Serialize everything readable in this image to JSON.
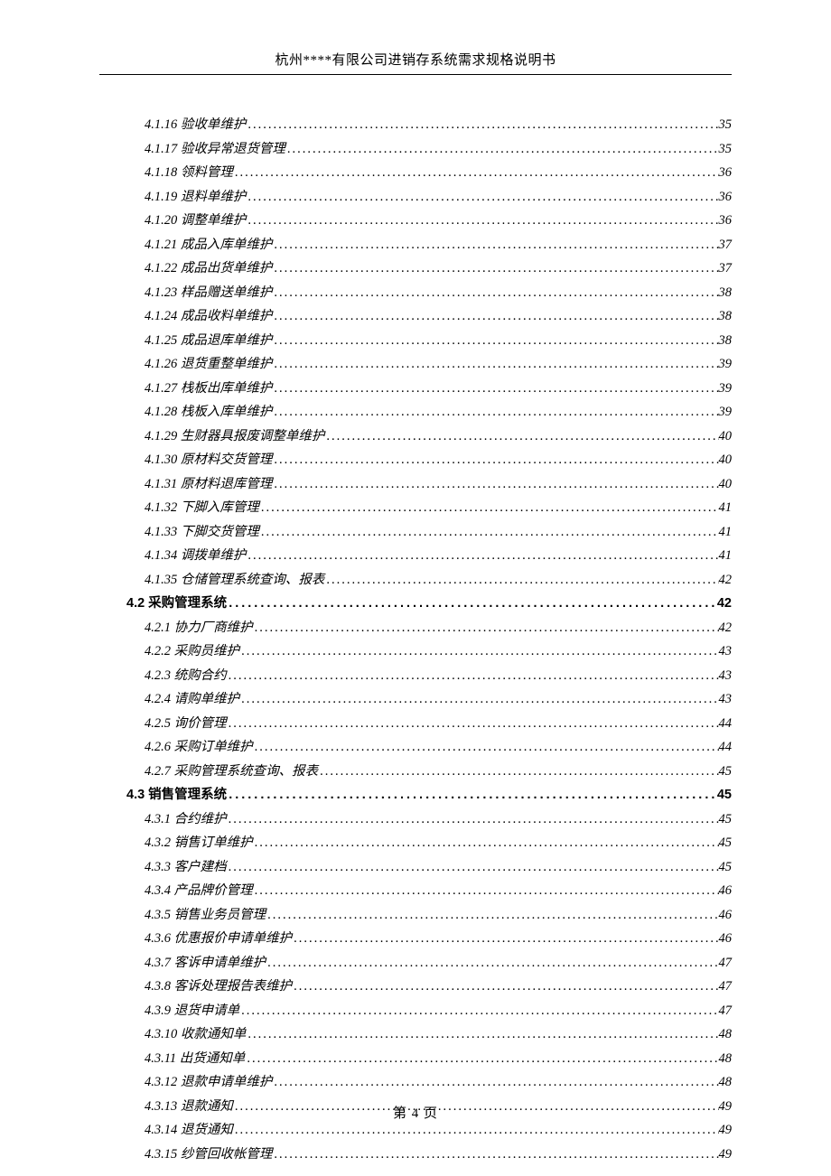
{
  "header_title": "杭州****有限公司进销存系统需求规格说明书",
  "footer_prefix": "第 ",
  "footer_page": "4",
  "footer_suffix": " 页",
  "toc": [
    {
      "level": 1,
      "num": "4.1.16",
      "title": "验收单维护",
      "page": "35"
    },
    {
      "level": 1,
      "num": "4.1.17",
      "title": "验收异常退货管理",
      "page": "35"
    },
    {
      "level": 1,
      "num": "4.1.18",
      "title": "领料管理",
      "page": "36"
    },
    {
      "level": 1,
      "num": "4.1.19",
      "title": "退料单维护",
      "page": "36"
    },
    {
      "level": 1,
      "num": "4.1.20",
      "title": "调整单维护",
      "page": "36"
    },
    {
      "level": 1,
      "num": "4.1.21",
      "title": "成品入库单维护",
      "page": "37"
    },
    {
      "level": 1,
      "num": "4.1.22",
      "title": "成品出货单维护",
      "page": "37"
    },
    {
      "level": 1,
      "num": "4.1.23",
      "title": "样品赠送单维护",
      "page": "38"
    },
    {
      "level": 1,
      "num": "4.1.24",
      "title": "成品收料单维护",
      "page": "38"
    },
    {
      "level": 1,
      "num": "4.1.25",
      "title": "成品退库单维护",
      "page": "38"
    },
    {
      "level": 1,
      "num": "4.1.26",
      "title": "退货重整单维护",
      "page": "39"
    },
    {
      "level": 1,
      "num": "4.1.27",
      "title": "栈板出库单维护",
      "page": "39"
    },
    {
      "level": 1,
      "num": "4.1.28",
      "title": "栈板入库单维护",
      "page": "39"
    },
    {
      "level": 1,
      "num": "4.1.29",
      "title": "生财器具报废调整单维护",
      "page": "40"
    },
    {
      "level": 1,
      "num": "4.1.30",
      "title": "原材料交货管理",
      "page": "40"
    },
    {
      "level": 1,
      "num": "4.1.31",
      "title": "原材料退库管理",
      "page": "40"
    },
    {
      "level": 1,
      "num": "4.1.32",
      "title": "下脚入库管理",
      "page": "41"
    },
    {
      "level": 1,
      "num": "4.1.33",
      "title": "下脚交货管理",
      "page": "41"
    },
    {
      "level": 1,
      "num": "4.1.34",
      "title": "调拨单维护",
      "page": "41"
    },
    {
      "level": 1,
      "num": "4.1.35",
      "title": "仓储管理系统查询、报表",
      "page": "42"
    },
    {
      "level": 0,
      "num": "4.2",
      "title": "采购管理系统",
      "page": "42"
    },
    {
      "level": 1,
      "num": "4.2.1",
      "title": "协力厂商维护",
      "page": "42"
    },
    {
      "level": 1,
      "num": "4.2.2",
      "title": "采购员维护",
      "page": "43"
    },
    {
      "level": 1,
      "num": "4.2.3",
      "title": "统购合约",
      "page": "43"
    },
    {
      "level": 1,
      "num": "4.2.4",
      "title": "请购单维护",
      "page": "43"
    },
    {
      "level": 1,
      "num": "4.2.5",
      "title": "询价管理",
      "page": "44"
    },
    {
      "level": 1,
      "num": "4.2.6",
      "title": "采购订单维护",
      "page": "44"
    },
    {
      "level": 1,
      "num": "4.2.7",
      "title": "采购管理系统查询、报表",
      "page": "45"
    },
    {
      "level": 0,
      "num": "4.3",
      "title": "销售管理系统",
      "page": "45"
    },
    {
      "level": 1,
      "num": "4.3.1",
      "title": "合约维护",
      "page": "45"
    },
    {
      "level": 1,
      "num": "4.3.2",
      "title": "销售订单维护",
      "page": "45"
    },
    {
      "level": 1,
      "num": "4.3.3",
      "title": "客户建档",
      "page": "45"
    },
    {
      "level": 1,
      "num": "4.3.4",
      "title": "产品牌价管理",
      "page": "46"
    },
    {
      "level": 1,
      "num": "4.3.5",
      "title": "销售业务员管理",
      "page": "46"
    },
    {
      "level": 1,
      "num": "4.3.6",
      "title": "优惠报价申请单维护",
      "page": "46"
    },
    {
      "level": 1,
      "num": "4.3.7",
      "title": "客诉申请单维护",
      "page": "47"
    },
    {
      "level": 1,
      "num": "4.3.8",
      "title": "客诉处理报告表维护",
      "page": "47"
    },
    {
      "level": 1,
      "num": "4.3.9",
      "title": "退货申请单",
      "page": "47"
    },
    {
      "level": 1,
      "num": "4.3.10",
      "title": "收款通知单",
      "page": "48"
    },
    {
      "level": 1,
      "num": "4.3.11",
      "title": "出货通知单",
      "page": "48"
    },
    {
      "level": 1,
      "num": "4.3.12",
      "title": "退款申请单维护",
      "page": "48"
    },
    {
      "level": 1,
      "num": "4.3.13",
      "title": "退款通知",
      "page": "49"
    },
    {
      "level": 1,
      "num": "4.3.14",
      "title": "退货通知",
      "page": "49"
    },
    {
      "level": 1,
      "num": "4.3.15",
      "title": "纱管回收帐管理",
      "page": "49"
    }
  ]
}
